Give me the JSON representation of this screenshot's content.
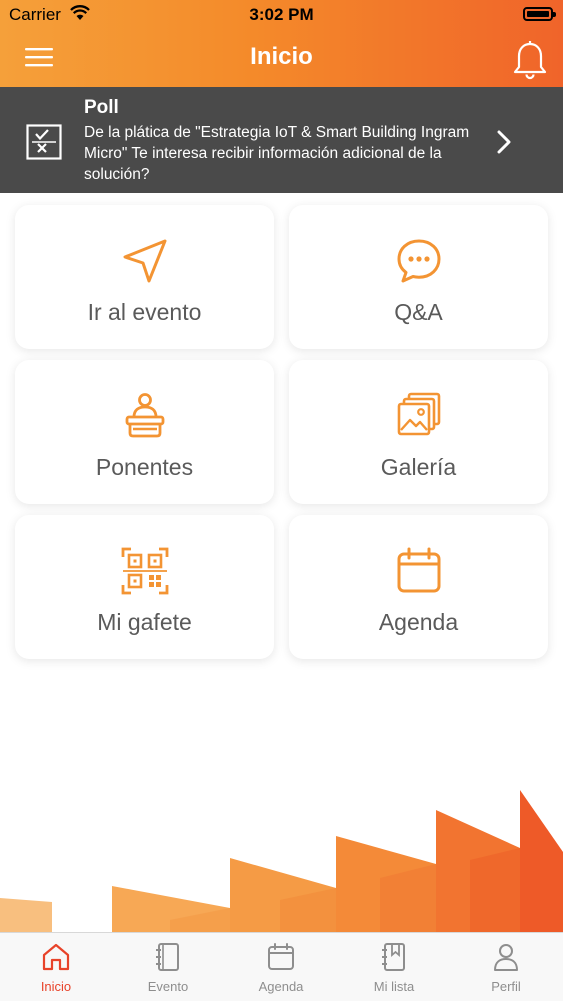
{
  "status_bar": {
    "carrier": "Carrier",
    "time": "3:02 PM"
  },
  "header": {
    "title": "Inicio",
    "menu_icon": "hamburger-menu-icon",
    "bell_icon": "bell-icon"
  },
  "poll": {
    "title": "Poll",
    "text": "De la plática de \"Estrategia IoT & Smart Building Ingram Micro\" Te interesa recibir información adicional de la solución?"
  },
  "tiles": [
    {
      "label": "Ir al evento",
      "icon": "navigation-arrow-icon"
    },
    {
      "label": "Q&A",
      "icon": "chat-bubble-icon"
    },
    {
      "label": "Ponentes",
      "icon": "speaker-podium-icon"
    },
    {
      "label": "Galería",
      "icon": "gallery-icon"
    },
    {
      "label": "Mi gafete",
      "icon": "qr-code-icon"
    },
    {
      "label": "Agenda",
      "icon": "calendar-icon"
    }
  ],
  "tabbar": {
    "items": [
      {
        "label": "Inicio",
        "active": true
      },
      {
        "label": "Evento",
        "active": false
      },
      {
        "label": "Agenda",
        "active": false
      },
      {
        "label": "Mi lista",
        "active": false
      },
      {
        "label": "Perfil",
        "active": false
      }
    ]
  },
  "colors": {
    "accent": "#F39433",
    "header_end": "#F0642A",
    "poll_bg": "#4A4A4A",
    "tab_active": "#E8432A"
  }
}
